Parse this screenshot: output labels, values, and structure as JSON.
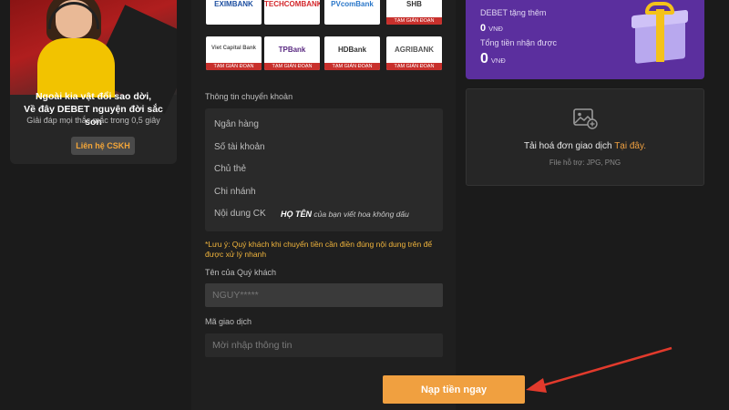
{
  "support": {
    "title_line1": "Ngoài kia vật đổi sao dời,",
    "title_line2": "Về đây DEBET nguyện đời sắc son",
    "subtitle": "Giải đáp mọi thắc mắc trong 0,5 giây",
    "contact_button": "Liên hệ CSKH"
  },
  "banks": [
    {
      "name": "EXIMBANK",
      "color": "#1d4fa0",
      "maintenance": ""
    },
    {
      "name": "TECHCOMBANK",
      "color": "#d3262a",
      "maintenance": ""
    },
    {
      "name": "PVcomBank",
      "color": "#2a77c9",
      "maintenance": ""
    },
    {
      "name": "SHB",
      "color": "#333333",
      "maintenance": "TẠM GIÁN ĐOẠN"
    },
    {
      "name": "Viet Capital Bank",
      "color": "#555555",
      "maintenance": "TẠM GIÁN ĐOẠN"
    },
    {
      "name": "TPBank",
      "color": "#5a2a82",
      "maintenance": "TẠM GIÁN ĐOẠN"
    },
    {
      "name": "HDBank",
      "color": "#333333",
      "maintenance": "TẠM GIÁN ĐOẠN"
    },
    {
      "name": "AGRIBANK",
      "color": "#555555",
      "maintenance": "TẠM GIÁN ĐOẠN"
    }
  ],
  "transfer": {
    "section_label": "Thông tin chuyển khoản",
    "rows": [
      "Ngân hàng",
      "Số tài khoản",
      "Chủ thẻ",
      "Chi nhánh",
      "Nội dung CK"
    ],
    "content_name": "HỌ TÊN",
    "content_hint": "của bạn viết hoa không dấu"
  },
  "warning": "*Lưu ý: Quý khách khi chuyển tiền cần điền đúng nội dung trên để được xử lý nhanh",
  "customer_name": {
    "label": "Tên của Quý khách",
    "value": "NGUY*****"
  },
  "transaction_code": {
    "label": "Mã giao dịch",
    "placeholder": "Mời nhập thông tin"
  },
  "submit_label": "Nạp tiền ngay",
  "bonus": {
    "bonus_label": "DEBET tặng thêm",
    "bonus_value": "0",
    "bonus_unit": "VNĐ",
    "total_label": "Tổng tiền nhận được",
    "total_value": "0",
    "total_unit": "VNĐ"
  },
  "upload": {
    "title": "Tải hoá đơn giao dịch",
    "link": "Tại đây.",
    "subtitle": "File hỗ trợ: JPG, PNG"
  },
  "colors": {
    "accent": "#f0a040",
    "bonus_bg": "#5b2f9e",
    "arrow": "#e23a2c"
  }
}
